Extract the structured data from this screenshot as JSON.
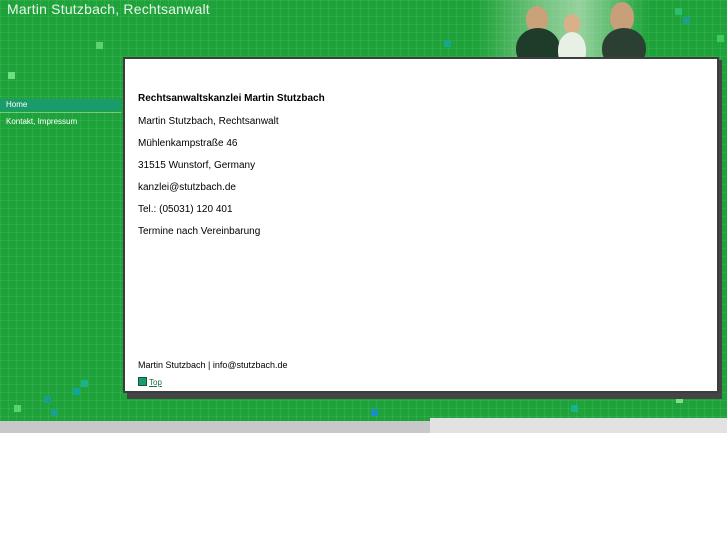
{
  "header": {
    "site_title": "Martin Stutzbach, Rechtsanwalt"
  },
  "nav": {
    "items": [
      {
        "label": "Home"
      },
      {
        "label": "Kontakt, Impressum"
      }
    ]
  },
  "main": {
    "heading": "Rechtsanwaltskanzlei Martin Stutzbach",
    "lines": [
      "Martin Stutzbach, Rechtsanwalt",
      "Mühlenkampstraße 46",
      "31515 Wunstorf, Germany",
      "kanzlei@stutzbach.de",
      "Tel.: (05031) 120 401",
      "Termine nach Vereinbarung"
    ],
    "footer": "Martin Stutzbach  | info@stutzbach.de",
    "top_link": "Top"
  },
  "colors": {
    "green": "#1ea33a",
    "nav_active": "#1a9b6b",
    "panel_border": "#3d3d3d"
  }
}
